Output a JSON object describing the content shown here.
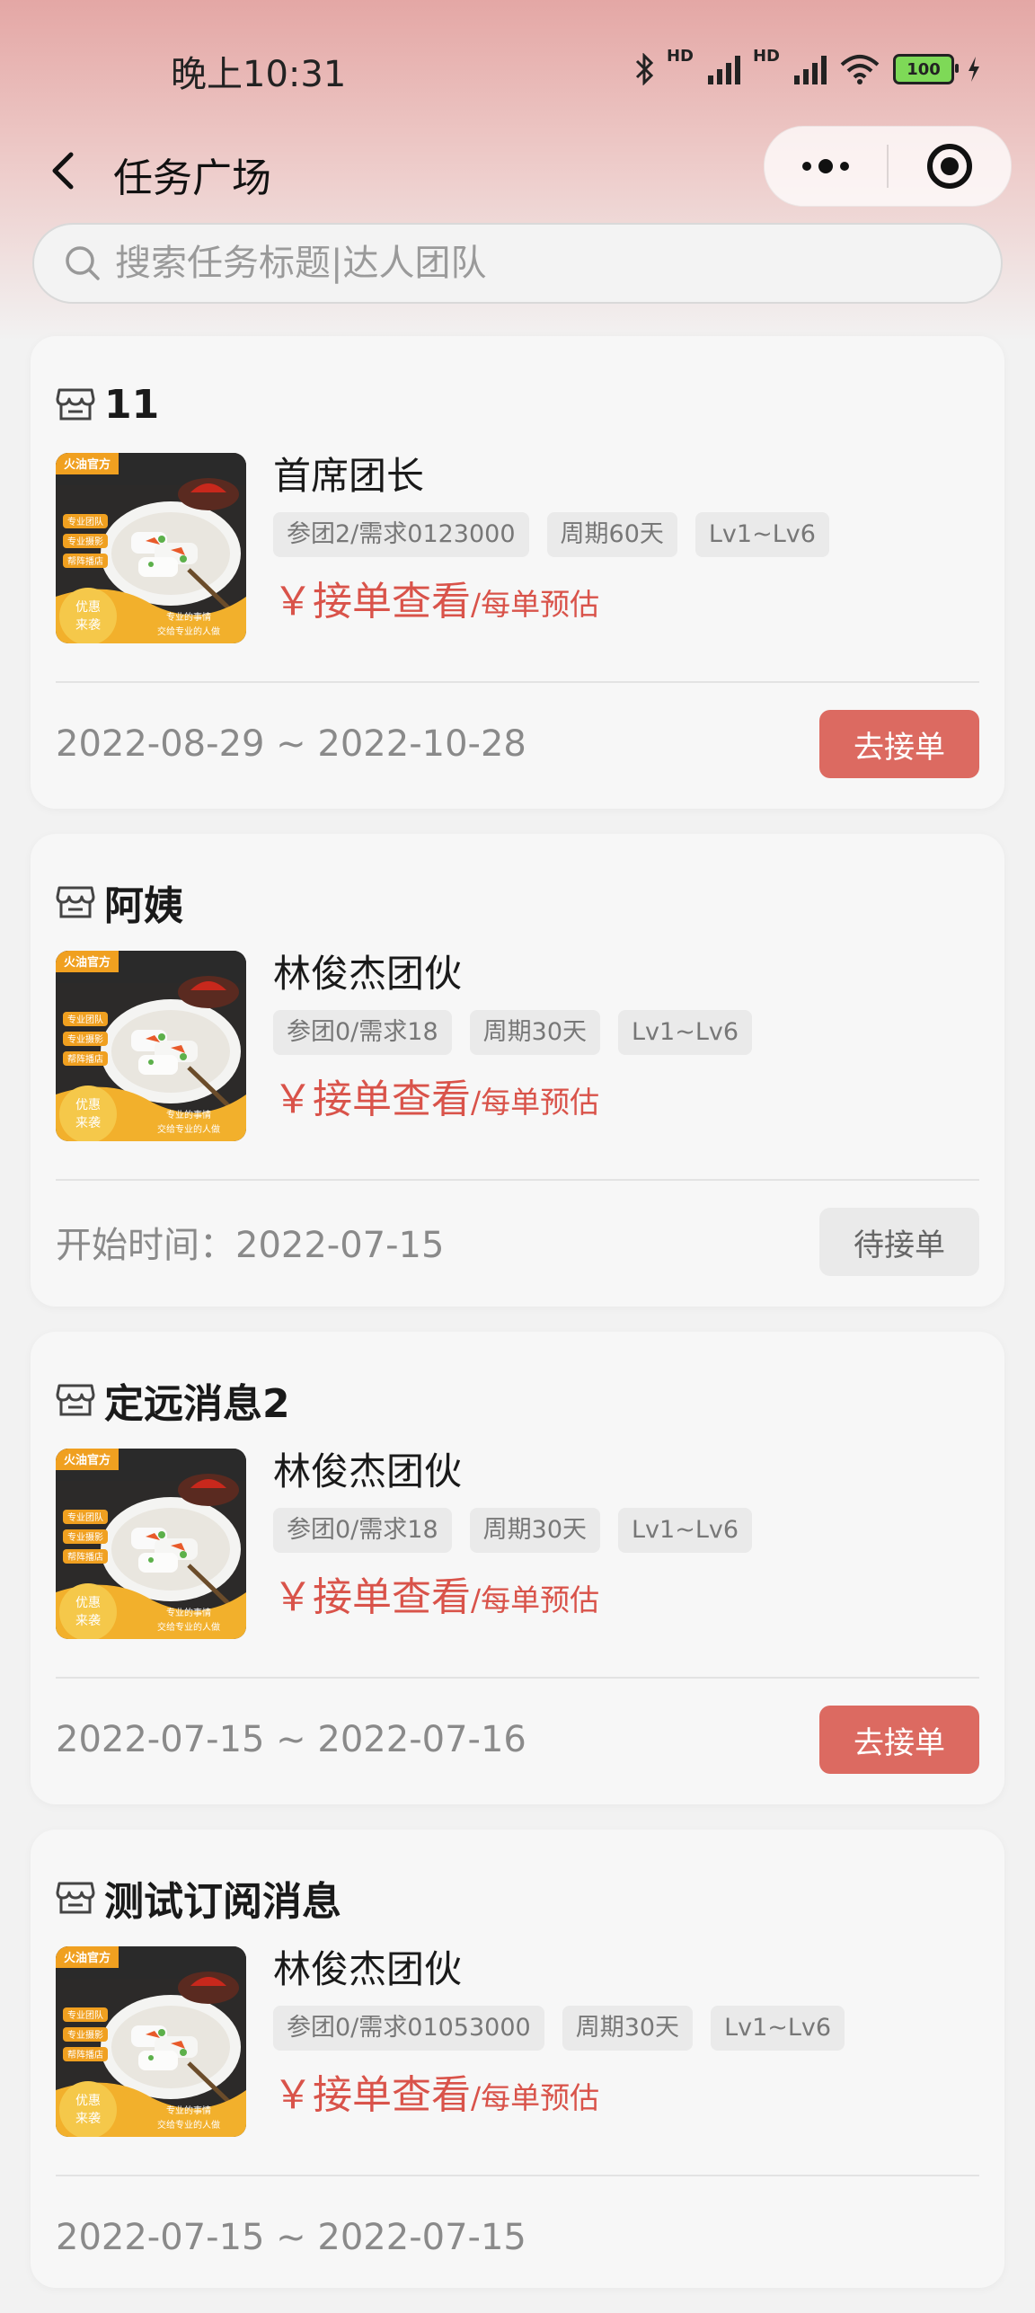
{
  "status_bar": {
    "time": "晚上10:31",
    "battery": "100",
    "network_tags": [
      "HD",
      "HD"
    ],
    "icons": [
      "bluetooth-icon",
      "signal-icon",
      "signal-icon",
      "wifi-icon",
      "battery-icon",
      "charging-icon"
    ]
  },
  "nav": {
    "title": "任务广场",
    "back_icon": "chevron-left-icon",
    "capsule_icons": [
      "more-dots-icon",
      "close-target-icon"
    ]
  },
  "search": {
    "placeholder": "搜索任务标题|达人团队",
    "icon": "search-icon"
  },
  "theme": {
    "accent": "#dc6a61",
    "price_color": "#d9534a",
    "header_gradient_top": "#e4a7a5"
  },
  "thumbnail": {
    "badge": "火油官方",
    "chips": [
      "专业团队",
      "专业摄影",
      "帮阵播店"
    ],
    "promo": "优惠来袭",
    "slogan_1": "专业的事情",
    "slogan_2": "交给专业的人做"
  },
  "tasks": [
    {
      "title": "11",
      "team": "首席团长",
      "tags": [
        "参团2/需求0123000",
        "周期60天",
        "Lv1~Lv6"
      ],
      "price_main": "￥接单查看",
      "price_unit": "/每单预估",
      "date": "2022-08-29 ~ 2022-10-28",
      "action": "去接单",
      "action_type": "primary"
    },
    {
      "title": "阿姨",
      "team": "林俊杰团伙",
      "tags": [
        "参团0/需求18",
        "周期30天",
        "Lv1~Lv6"
      ],
      "price_main": "￥接单查看",
      "price_unit": "/每单预估",
      "date": "开始时间：2022-07-15",
      "action": "待接单",
      "action_type": "waiting"
    },
    {
      "title": "定远消息2",
      "team": "林俊杰团伙",
      "tags": [
        "参团0/需求18",
        "周期30天",
        "Lv1~Lv6"
      ],
      "price_main": "￥接单查看",
      "price_unit": "/每单预估",
      "date": "2022-07-15 ~ 2022-07-16",
      "action": "去接单",
      "action_type": "primary"
    },
    {
      "title": "测试订阅消息",
      "team": "林俊杰团伙",
      "tags": [
        "参团0/需求01053000",
        "周期30天",
        "Lv1~Lv6"
      ],
      "price_main": "￥接单查看",
      "price_unit": "/每单预估",
      "date": "2022-07-15 ~ 2022-07-15",
      "action": "",
      "action_type": "none"
    }
  ]
}
